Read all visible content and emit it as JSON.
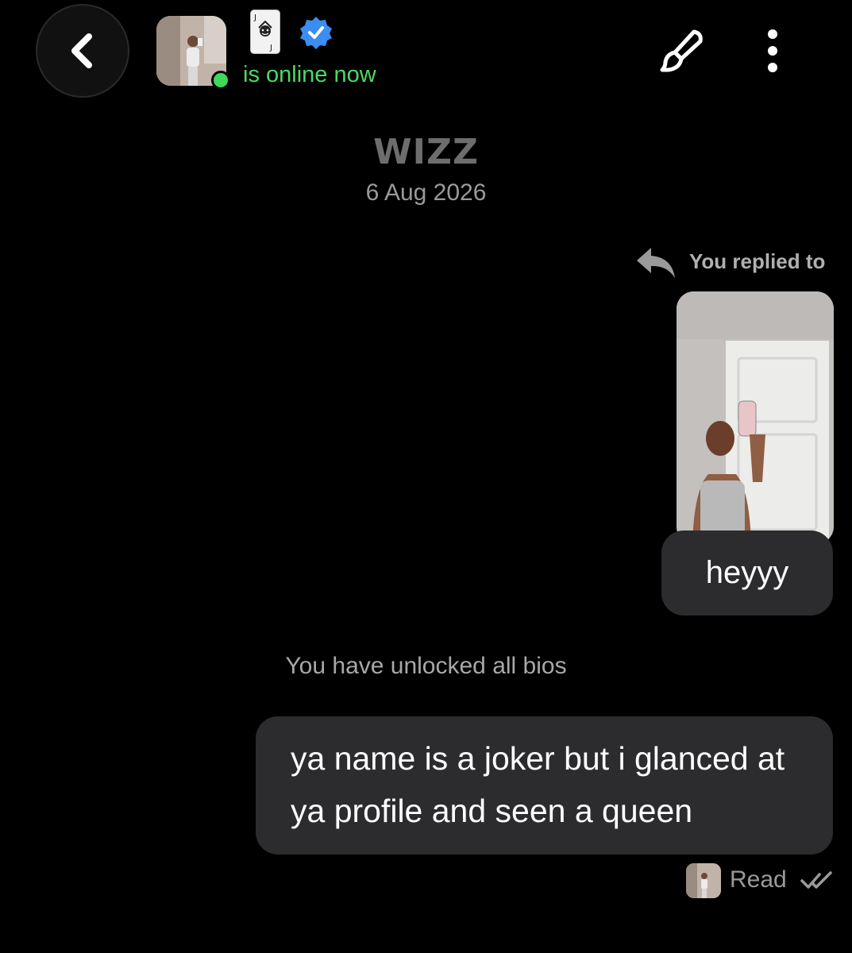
{
  "header": {
    "status": "is online now",
    "icons": {
      "back": "chevron-left-icon",
      "card": "joker-card-icon",
      "verified": "verified-badge-icon",
      "brush": "paintbrush-icon",
      "more": "more-vertical-icon"
    },
    "colors": {
      "online": "#4cd964",
      "verified": "#3b8ef0"
    }
  },
  "conversation": {
    "app_logo": "WIZZ",
    "date": "6 Aug 2026",
    "reply_label": "You replied to",
    "messages": [
      {
        "text": "heyyy",
        "outgoing": true
      },
      {
        "text": "ya name is a joker but i glanced at ya profile and seen a queen",
        "outgoing": true
      }
    ],
    "system_notice": "You have unlocked all bios",
    "receipt": "Read"
  }
}
